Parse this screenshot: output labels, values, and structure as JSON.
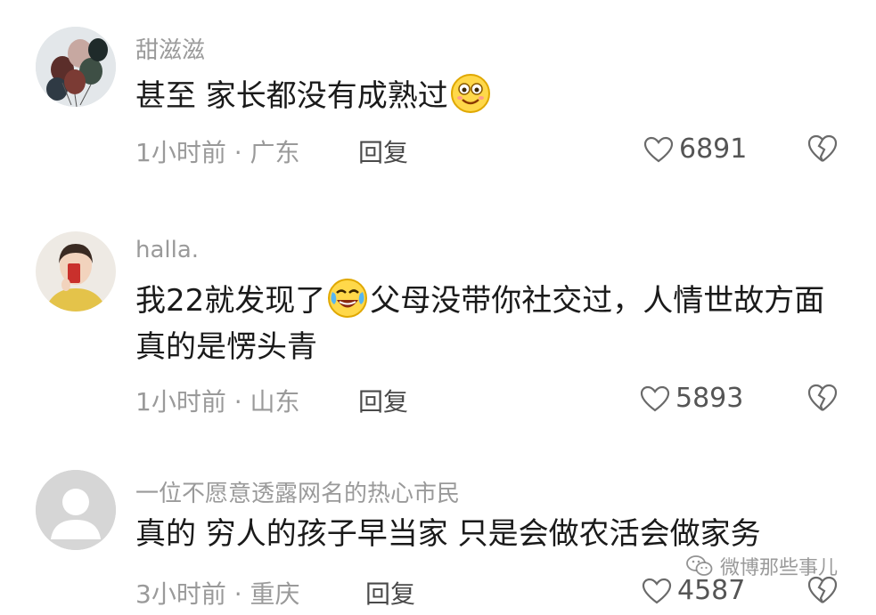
{
  "comments": [
    {
      "username": "甜滋滋",
      "text": "甚至 家长都没有成熟过",
      "emoji": "smile-emoji",
      "time_location": "1小时前 · 广东",
      "reply_label": "回复",
      "likes": "6891"
    },
    {
      "username": "halla.",
      "text_before": "我22就发现了",
      "emoji": "laugh-cry-emoji",
      "text_after": "父母没带你社交过，人情世故方面真的是愣头青",
      "time_location": "1小时前 · 山东",
      "reply_label": "回复",
      "likes": "5893"
    },
    {
      "username": "一位不愿意透露网名的热心市民",
      "text": "真的 穷人的孩子早当家 只是会做农活会做家务",
      "time_location": "3小时前 · 重庆",
      "reply_label": "回复",
      "likes": "4587"
    }
  ],
  "watermark": "微博那些事儿",
  "icons": {
    "like": "heart-icon",
    "dislike": "broken-heart-icon",
    "watermark": "wechat-icon"
  },
  "colors": {
    "username": "#9a9a9a",
    "text": "#1a1a1a",
    "meta": "#9a9a9a"
  }
}
